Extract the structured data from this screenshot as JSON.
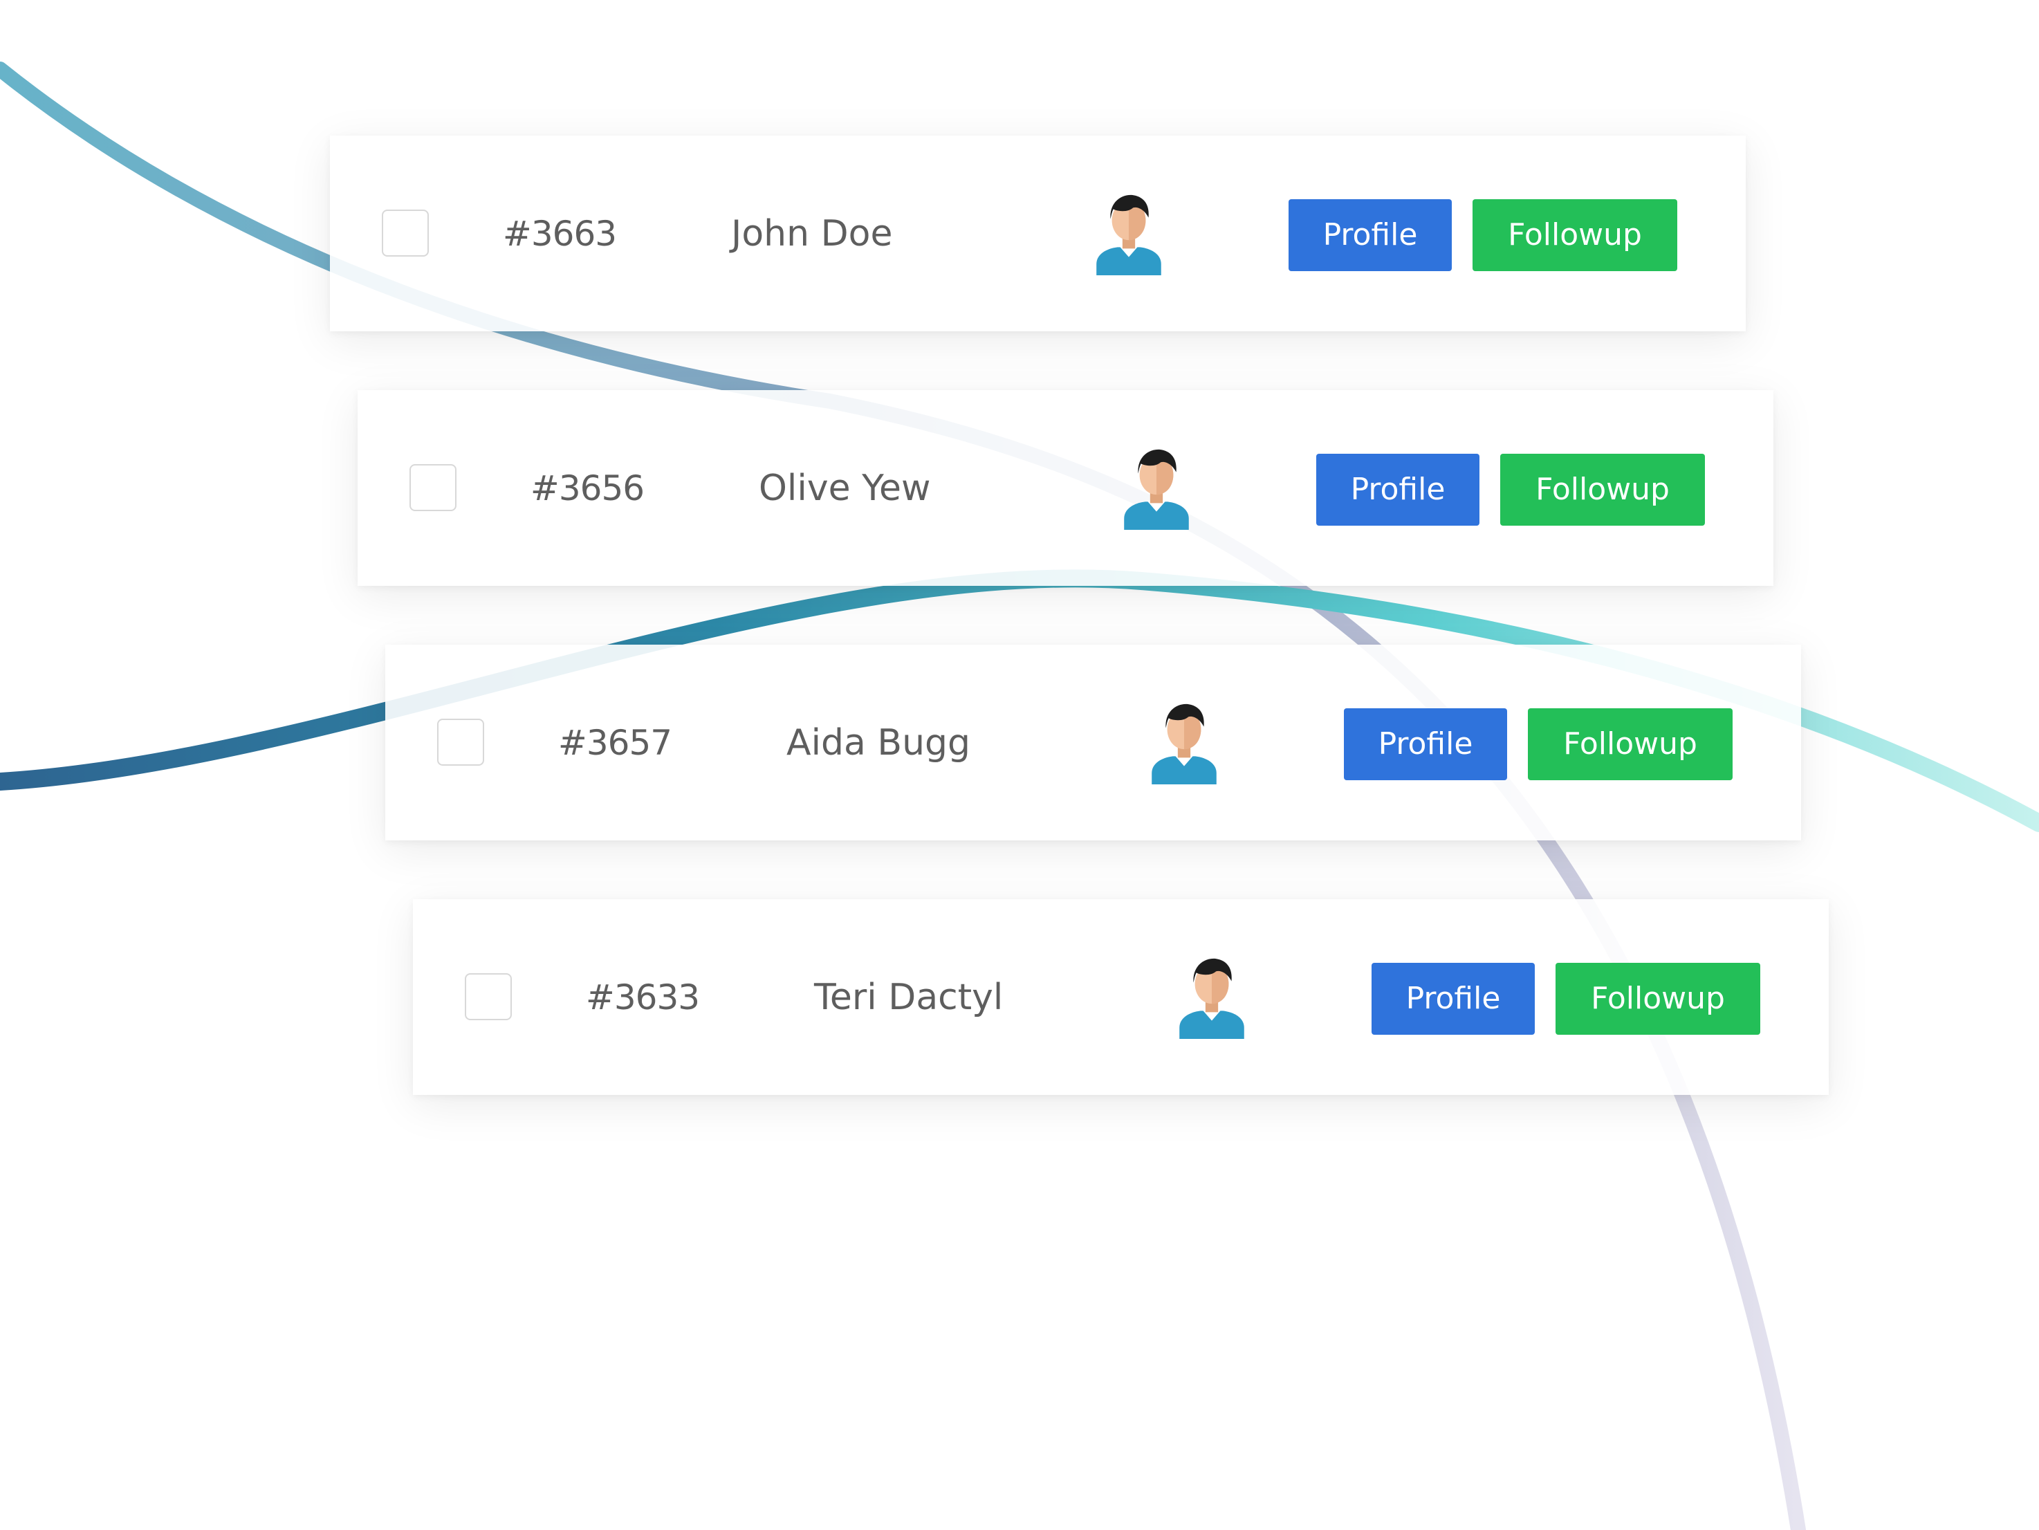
{
  "rows": [
    {
      "id": "#3663",
      "name": "John Doe",
      "profile_label": "Profile",
      "followup_label": "Followup"
    },
    {
      "id": "#3656",
      "name": "Olive Yew",
      "profile_label": "Profile",
      "followup_label": "Followup"
    },
    {
      "id": "#3657",
      "name": "Aida Bugg",
      "profile_label": "Profile",
      "followup_label": "Followup"
    },
    {
      "id": "#3633",
      "name": "Teri Dactyl",
      "profile_label": "Profile",
      "followup_label": "Followup"
    }
  ],
  "icons": {
    "avatar": "user-avatar-icon"
  },
  "colors": {
    "profile_button": "#2f73dc",
    "followup_button": "#23bf58",
    "text": "#5e5e5e",
    "background": "#ffffff"
  }
}
